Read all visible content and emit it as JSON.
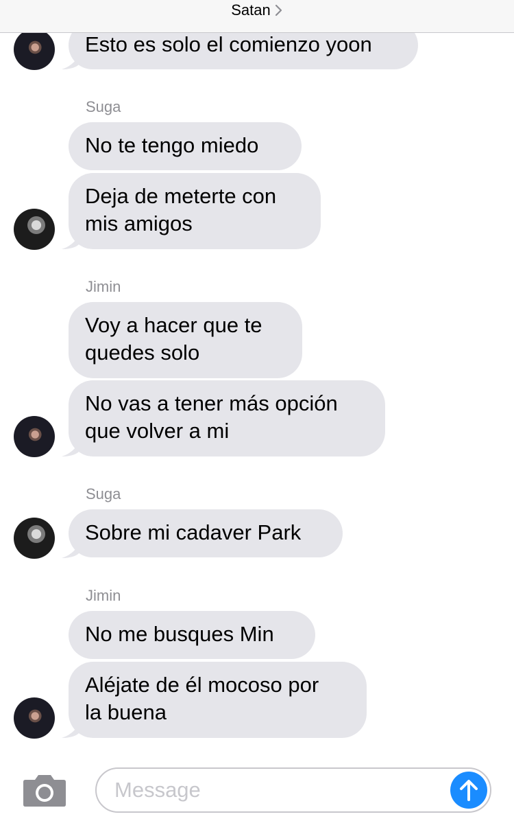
{
  "header": {
    "title": "Satan"
  },
  "messages": [
    {
      "text": "Esto es solo el comienzo yoon"
    },
    {
      "sender": "Suga"
    },
    {
      "text": "No te tengo miedo"
    },
    {
      "text": "Deja de meterte con mis amigos",
      "line1": "Deja de meterte con",
      "line2": "mis amigos"
    },
    {
      "sender": "Jimin"
    },
    {
      "line1": "Voy a hacer que te",
      "line2": "quedes solo"
    },
    {
      "line1": "No vas a tener más opción",
      "line2": "que volver a mi"
    },
    {
      "sender": "Suga"
    },
    {
      "text": "Sobre mi cadaver Park"
    },
    {
      "sender": "Jimin"
    },
    {
      "text": "No me busques Min"
    },
    {
      "line1": "Aléjate de él mocoso por",
      "line2": "la buena"
    }
  ],
  "composer": {
    "placeholder": "Message"
  },
  "colors": {
    "bubble": "#e5e5ea",
    "send": "#1a8cff",
    "sender_label": "#8e8e93"
  },
  "icons": [
    "chevron-right-icon",
    "camera-icon",
    "send-arrow-icon"
  ]
}
